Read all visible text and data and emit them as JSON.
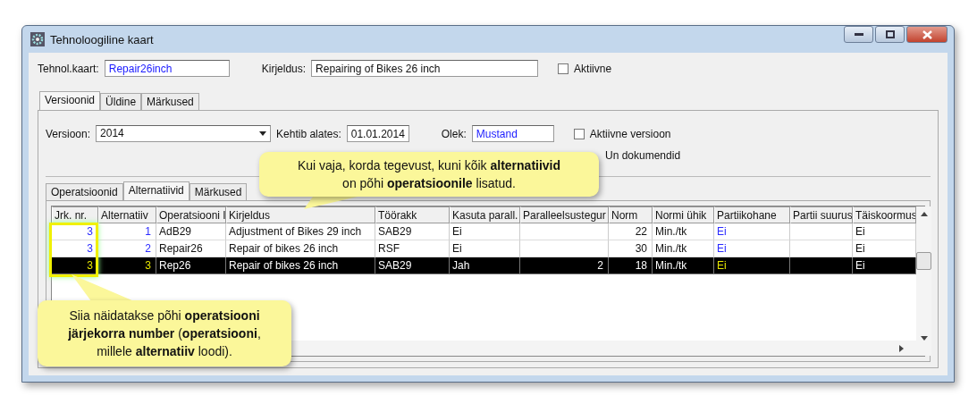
{
  "window": {
    "title": "Tehnoloogiline kaart"
  },
  "header": {
    "card_label": "Tehnol.kaart:",
    "card_value": "Repair26inch",
    "description_label": "Kirjeldus:",
    "description_value": "Repairing of Bikes 26 inch",
    "active": {
      "label": "Aktiivne",
      "checked": false
    }
  },
  "tabs": [
    {
      "label": "Versioonid",
      "selected": true
    },
    {
      "label": "Üldine",
      "selected": false
    },
    {
      "label": "Märkused",
      "selected": false
    }
  ],
  "version": {
    "label": "Versioon:",
    "value": "2014",
    "valid_from_label": "Kehtib alates:",
    "valid_from_value": "01.01.2014",
    "status_label": "Olek:",
    "status_value": "Mustand",
    "active_version": {
      "label": "Aktiivne versioon",
      "checked": false
    },
    "documents_label": "Un dokumendid"
  },
  "subtabs": [
    {
      "label": "Operatsioonid",
      "selected": false
    },
    {
      "label": "Alternatiivid",
      "selected": true
    },
    {
      "label": "Märkused",
      "selected": false
    }
  ],
  "table": {
    "columns": [
      {
        "label": "Jrk. nr.",
        "kind": "ref-number"
      },
      {
        "label": "Alternatiiv",
        "kind": "ref-number"
      },
      {
        "label": "Operatsiooni I",
        "kind": "text"
      },
      {
        "label": "Kirjeldus",
        "kind": "text"
      },
      {
        "label": "Töörakk",
        "kind": "text"
      },
      {
        "label": "Kasuta parall.",
        "kind": "text"
      },
      {
        "label": "Paralleelsustegur",
        "kind": "number"
      },
      {
        "label": "Norm",
        "kind": "number"
      },
      {
        "label": "Normi ühik",
        "kind": "text"
      },
      {
        "label": "Partiikohane",
        "kind": "ref"
      },
      {
        "label": "Partii suurus",
        "kind": "text"
      },
      {
        "label": "Täiskoormus",
        "kind": "text"
      }
    ],
    "rows": [
      {
        "selected": false,
        "cells": [
          "3",
          "1",
          "AdB29",
          "Adjustment of Bikes 29 inch",
          "SAB29",
          "Ei",
          "",
          "22",
          "Min./tk",
          "Ei",
          "",
          "Ei"
        ]
      },
      {
        "selected": false,
        "cells": [
          "3",
          "2",
          "Repair26",
          "Repair of bikes 26 inch",
          "RSF",
          "Ei",
          "",
          "30",
          "Min./tk",
          "Ei",
          "",
          "Ei"
        ]
      },
      {
        "selected": true,
        "cells": [
          "3",
          "3",
          "Rep26",
          "Repair of bikes 26 inch",
          "SAB29",
          "Jah",
          "2",
          "18",
          "Min./tk",
          "Ei",
          "",
          "Ei"
        ]
      }
    ]
  },
  "callouts": [
    {
      "text": "Kui vaja, korda tegevust, kuni kõik **alternatiivid** on põhi **operatsioonile** lisatud."
    },
    {
      "text": "Siia näidatakse põhi **operatsiooni järjekorra number** (**operatsiooni**, millele **alternatiiv** loodi)."
    }
  ]
}
